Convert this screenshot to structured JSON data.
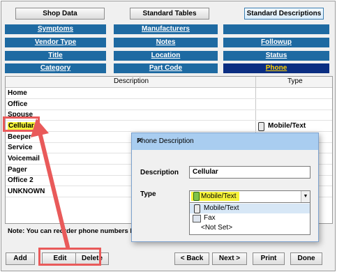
{
  "tabs": [
    {
      "label": "Shop Data",
      "active": false
    },
    {
      "label": "Standard Tables",
      "active": false
    },
    {
      "label": "Standard Descriptions",
      "active": true
    }
  ],
  "nav": {
    "col1": [
      "Symptoms",
      "Vendor Type",
      "Title",
      "Category"
    ],
    "col2": [
      "Manufacturers",
      "Notes",
      "Location",
      "Part Code"
    ],
    "col3": [
      "",
      "Followup",
      "Status",
      "Phone"
    ]
  },
  "grid": {
    "headers": {
      "description": "Description",
      "type": "Type"
    },
    "rows": [
      {
        "description": "Home",
        "type": ""
      },
      {
        "description": "Office",
        "type": ""
      },
      {
        "description": "Spouse",
        "type": ""
      },
      {
        "description": "Cellular",
        "type": "Mobile/Text"
      },
      {
        "description": "Beeper",
        "type": ""
      },
      {
        "description": "Service",
        "type": ""
      },
      {
        "description": "Voicemail",
        "type": ""
      },
      {
        "description": "Pager",
        "type": ""
      },
      {
        "description": "Office 2",
        "type": ""
      },
      {
        "description": "UNKNOWN",
        "type": ""
      }
    ]
  },
  "note": "Note: You can reorder phone numbers b",
  "buttons": {
    "add": "Add",
    "edit": "Edit",
    "delete": "Delete",
    "back": "< Back",
    "next": "Next >",
    "print": "Print",
    "done": "Done"
  },
  "dialog": {
    "title": "Phone Description",
    "close": "✕",
    "description_label": "Description",
    "description_value": "Cellular",
    "type_label": "Type",
    "type_value": "Mobile/Text",
    "arrow": "▼",
    "options": [
      "Mobile/Text",
      "Fax",
      "<Not Set>"
    ]
  },
  "colors": {
    "nav": "#1e6aa2",
    "nav_selected": "#0b2e82",
    "highlight": "#f6f33a",
    "annotation": "#e95a5a"
  }
}
